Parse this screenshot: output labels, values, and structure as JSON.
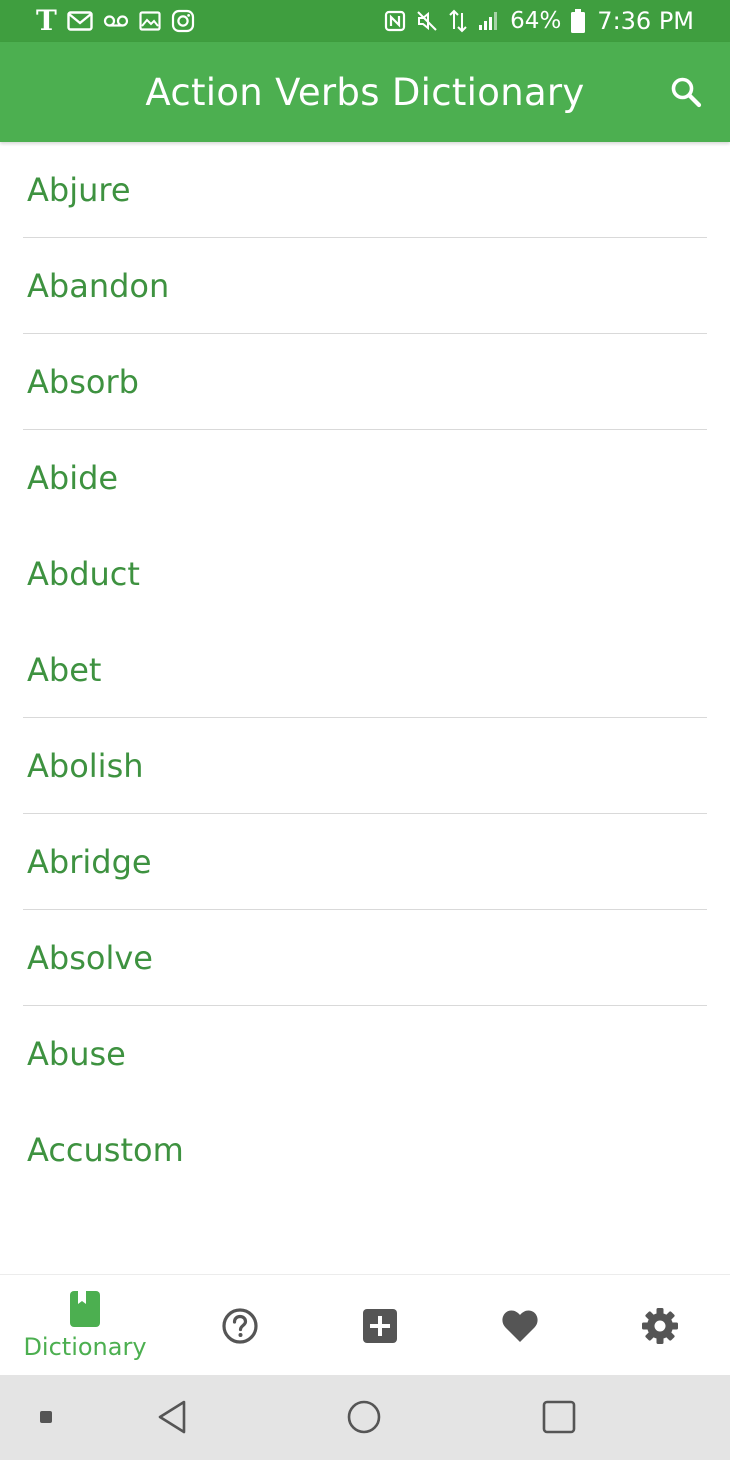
{
  "status_bar": {
    "carrier_glyph": "T",
    "battery": "64%",
    "time": "7:36 PM",
    "left_icons": [
      "tmobile-icon",
      "gmail-icon",
      "voicemail-icon",
      "gallery-icon",
      "instagram-icon"
    ],
    "right_icons": [
      "nfc-icon",
      "mute-icon",
      "data-icon",
      "signal-icon",
      "battery-icon"
    ]
  },
  "app_bar": {
    "title": "Action Verbs Dictionary",
    "search_icon": "search-icon"
  },
  "verbs": [
    {
      "label": "Abjure",
      "divider": true
    },
    {
      "label": "Abandon",
      "divider": true
    },
    {
      "label": "Absorb",
      "divider": true
    },
    {
      "label": "Abide",
      "divider": false
    },
    {
      "label": "Abduct",
      "divider": false
    },
    {
      "label": "Abet",
      "divider": true
    },
    {
      "label": "Abolish",
      "divider": true
    },
    {
      "label": "Abridge",
      "divider": true
    },
    {
      "label": "Absolve",
      "divider": true
    },
    {
      "label": "Abuse",
      "divider": false
    },
    {
      "label": "Accustom",
      "divider": false
    }
  ],
  "bottom_nav": {
    "active_label": "Dictionary",
    "items": [
      {
        "icon": "book-icon",
        "label": "Dictionary",
        "active": true
      },
      {
        "icon": "help-icon",
        "active": false
      },
      {
        "icon": "add-icon",
        "active": false
      },
      {
        "icon": "heart-icon",
        "active": false
      },
      {
        "icon": "gear-icon",
        "active": false
      }
    ]
  },
  "colors": {
    "status_bar": "#3f9e3f",
    "app_bar": "#4caf50",
    "list_text": "#3e9240",
    "nav_active": "#4caf50",
    "nav_inactive": "#555555",
    "divider": "#d9d9d9",
    "system_nav": "#e4e4e4"
  }
}
